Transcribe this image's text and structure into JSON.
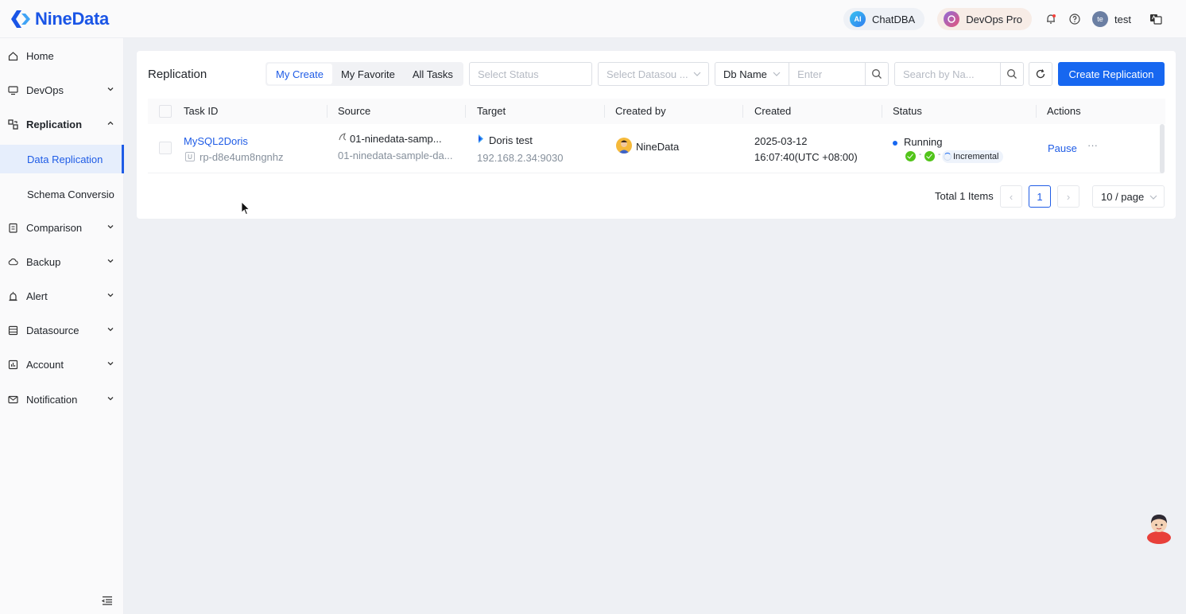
{
  "header": {
    "brand": "NineData",
    "chatdba_label": "ChatDBA",
    "chatdba_icon_text": "AI",
    "devops_label": "DevOps Pro",
    "user_name": "test",
    "user_initial": "te"
  },
  "sidebar": {
    "items": [
      {
        "label": "Home",
        "icon": "home-icon"
      },
      {
        "label": "DevOps",
        "icon": "monitor-icon"
      },
      {
        "label": "Replication",
        "icon": "replication-icon",
        "expanded": true
      },
      {
        "label": "Comparison",
        "icon": "clipboard-icon"
      },
      {
        "label": "Backup",
        "icon": "cloud-icon"
      },
      {
        "label": "Alert",
        "icon": "siren-icon"
      },
      {
        "label": "Datasource",
        "icon": "datasource-icon"
      },
      {
        "label": "Account",
        "icon": "account-icon"
      },
      {
        "label": "Notification",
        "icon": "mail-icon"
      }
    ],
    "sub_items": [
      {
        "label": "Data Replication",
        "active": true
      },
      {
        "label": "Schema Conversio",
        "active": false
      }
    ]
  },
  "toolbar": {
    "title": "Replication",
    "tabs": [
      {
        "label": "My Create",
        "active": true
      },
      {
        "label": "My Favorite",
        "active": false
      },
      {
        "label": "All Tasks",
        "active": false
      }
    ],
    "status_placeholder": "Select Status",
    "datasource_placeholder": "Select Datasou ...",
    "db_field_label": "Db Name",
    "db_input_placeholder": "Enter",
    "name_search_placeholder": "Search by Na...",
    "create_button": "Create Replication"
  },
  "table": {
    "columns": [
      "Task ID",
      "Source",
      "Target",
      "Created by",
      "Created",
      "Status",
      "Actions"
    ],
    "rows": [
      {
        "task_name": "MySQL2Doris",
        "task_id": "rp-d8e4um8ngnhz",
        "task_type_badge": "U",
        "source_name": "01-ninedata-samp...",
        "source_detail": "01-ninedata-sample-da...",
        "target_name": "Doris test",
        "target_address": "192.168.2.34:9030",
        "created_by": "NineData",
        "created_date": "2025-03-12",
        "created_time": "16:07:40(UTC +08:00)",
        "status": "Running",
        "phase_label": "Incremental",
        "action_primary": "Pause",
        "action_more": "···"
      }
    ]
  },
  "pagination": {
    "total_text": "Total 1 Items",
    "current_page": "1",
    "page_size": "10 / page",
    "prev": "‹",
    "next": "›"
  },
  "colors": {
    "brand": "#1a55e6",
    "primary": "#1767f0",
    "success": "#52c41a"
  }
}
